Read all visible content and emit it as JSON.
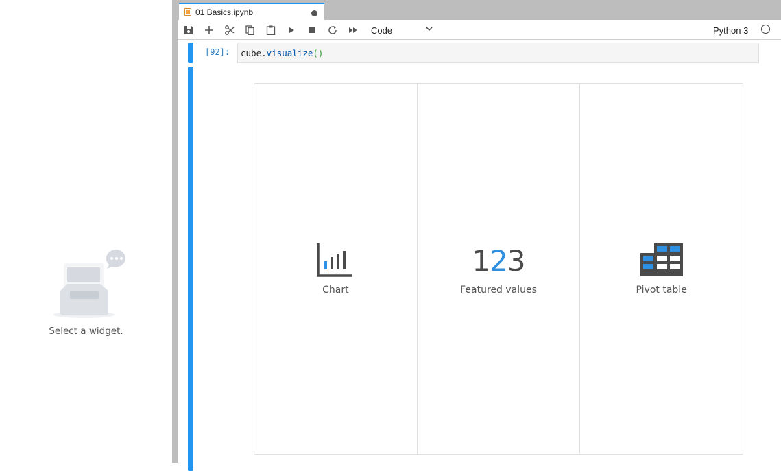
{
  "sidebar": {
    "empty_message": "Select a widget."
  },
  "tab": {
    "title": "01 Basics.ipynb"
  },
  "toolbar": {
    "cell_type": "Code",
    "kernel_name": "Python 3",
    "buttons": [
      "save-icon",
      "add-icon",
      "cut-icon",
      "copy-icon",
      "paste-icon",
      "run-icon",
      "stop-icon",
      "restart-icon",
      "fast-forward-icon"
    ]
  },
  "cell": {
    "prompt": "[92]:",
    "code_obj": "cube",
    "code_dot": ".",
    "code_fn": "visualize",
    "code_parens": "()"
  },
  "widget": {
    "options": [
      {
        "label": "Chart"
      },
      {
        "label": "Featured values",
        "digits": [
          "1",
          "2",
          "3"
        ]
      },
      {
        "label": "Pivot table"
      }
    ]
  },
  "colors": {
    "accent": "#2196f3",
    "digit_blue": "#2f8fe0",
    "icon_dark": "#4a4a4a"
  }
}
